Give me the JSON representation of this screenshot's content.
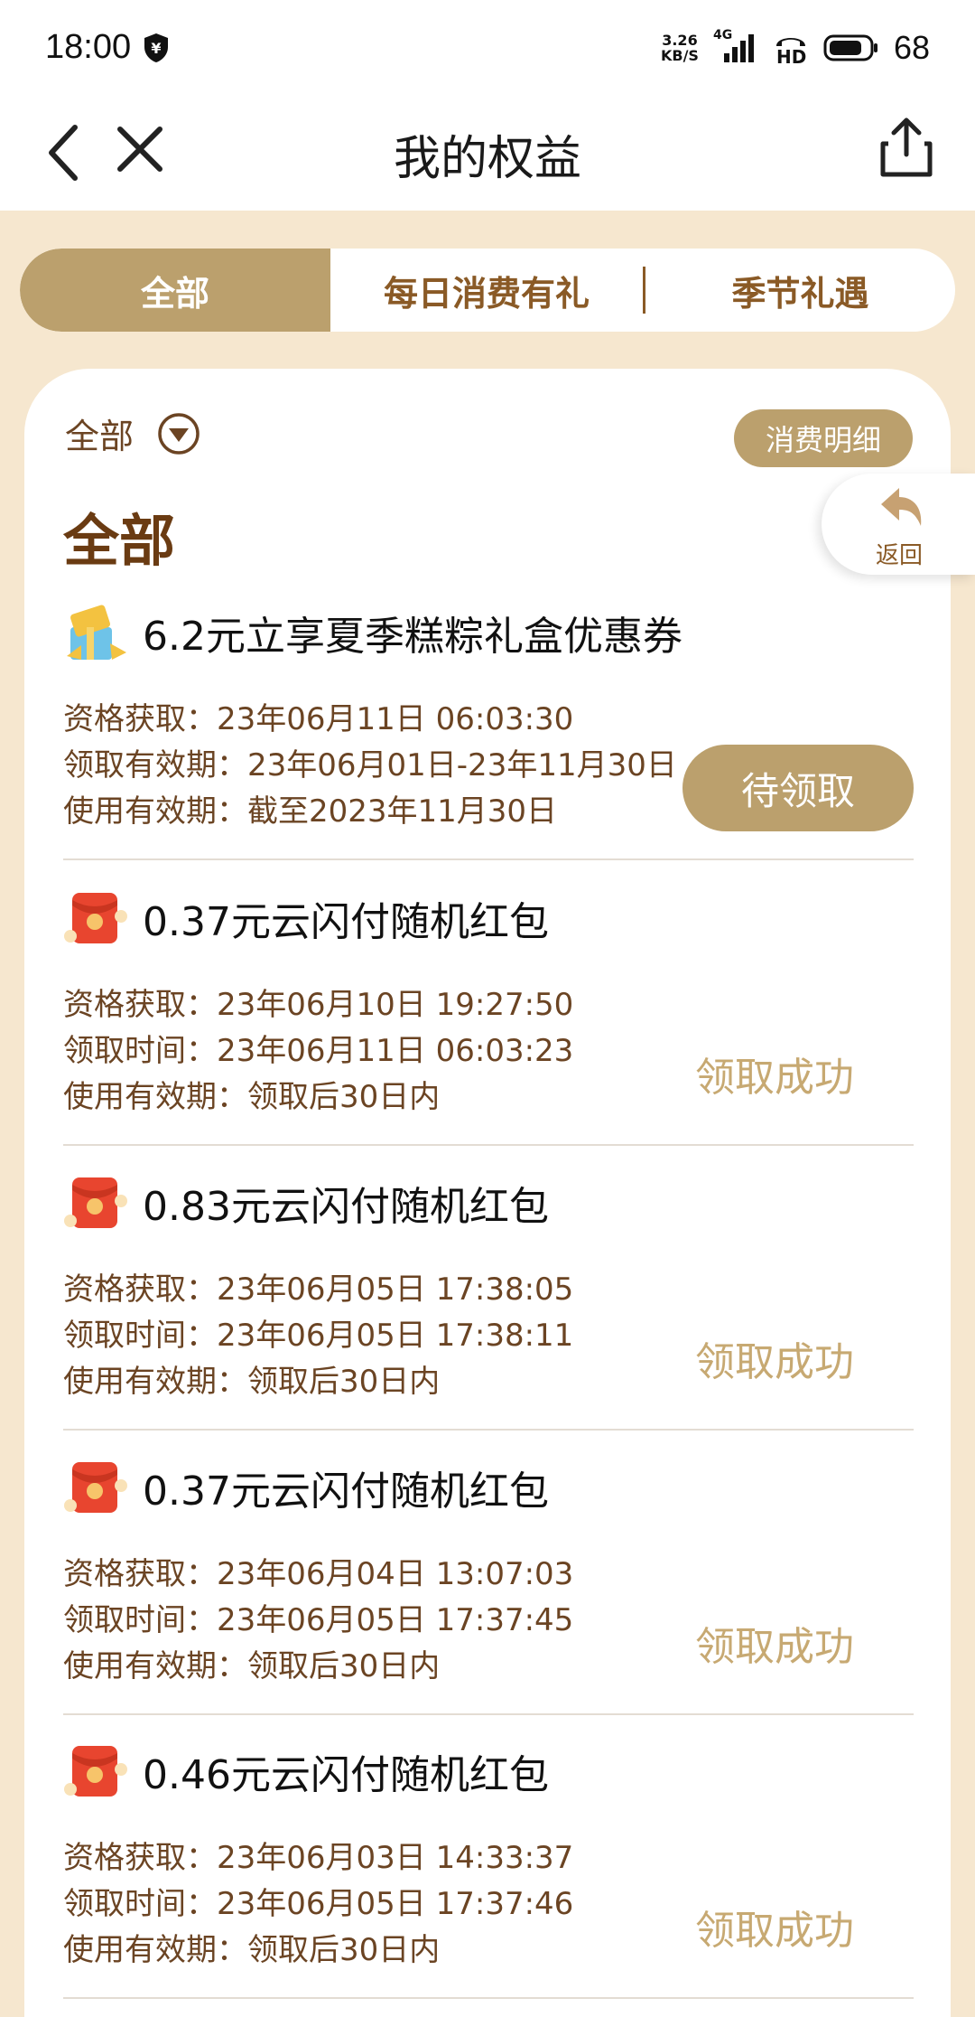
{
  "status_bar": {
    "time": "18:00",
    "net_speed_value": "3.26",
    "net_speed_unit": "KB/S",
    "network": "4G",
    "hd": "HD",
    "battery": "68"
  },
  "nav": {
    "title": "我的权益"
  },
  "tabs": {
    "all": "全部",
    "daily": "每日消费有礼",
    "season": "季节礼遇"
  },
  "filter": {
    "label": "全部"
  },
  "detail_button": "消费明细",
  "section_title": "全部",
  "float_back_label": "返回",
  "items": [
    {
      "title": "6.2元立享夏季糕粽礼盒优惠券",
      "line1": "资格获取：23年06月11日 06:03:30",
      "line2": "领取有效期：23年06月01日-23年11月30日",
      "line3": "使用有效期：截至2023年11月30日",
      "status": "待领取"
    },
    {
      "title": "0.37元云闪付随机红包",
      "line1": "资格获取：23年06月10日 19:27:50",
      "line2": "领取时间：23年06月11日 06:03:23",
      "line3": "使用有效期：领取后30日内",
      "status": "领取成功"
    },
    {
      "title": "0.83元云闪付随机红包",
      "line1": "资格获取：23年06月05日 17:38:05",
      "line2": "领取时间：23年06月05日 17:38:11",
      "line3": "使用有效期：领取后30日内",
      "status": "领取成功"
    },
    {
      "title": "0.37元云闪付随机红包",
      "line1": "资格获取：23年06月04日 13:07:03",
      "line2": "领取时间：23年06月05日 17:37:45",
      "line3": "使用有效期：领取后30日内",
      "status": "领取成功"
    },
    {
      "title": "0.46元云闪付随机红包",
      "line1": "资格获取：23年06月03日 14:33:37",
      "line2": "领取时间：23年06月05日 17:37:46",
      "line3": "使用有效期：领取后30日内",
      "status": "领取成功"
    }
  ],
  "colors": {
    "accent_gold": "#bba06d",
    "brown_text": "#6b4423",
    "success_gold": "#c7a972",
    "page_bg": "#f6e7cf"
  }
}
